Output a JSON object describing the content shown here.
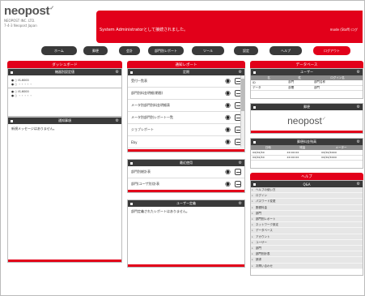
{
  "header": {
    "logo_text": "neopost",
    "logo_mark": "✓",
    "logo_lines": [
      "NEOPOST INC. LTD.",
      "7-4-3 Neopost Japan"
    ],
    "banner_msg": "System Administratorとして接続されました。",
    "banner_user": "mode (Stoff) ログ"
  },
  "nav": [
    {
      "label": "ホーム"
    },
    {
      "label": "郵便"
    },
    {
      "label": "会計"
    },
    {
      "label": "部門別レポート"
    },
    {
      "label": "ツール"
    },
    {
      "label": "設定"
    },
    {
      "label": "ヘルプ"
    },
    {
      "label": "ログアウト",
      "active": true
    }
  ],
  "dashboard": {
    "title": "ダッシュボード",
    "panel1_head": "機器別設定値",
    "tree": [
      "● ○ IS-6000",
      "● ○ ・・・・・",
      "● ○ IS-6000",
      "● ○ ・・・・・"
    ],
    "panel2_head": "通知事項",
    "panel2_text": "新規メッセージはありません。"
  },
  "reports": {
    "title": "通知レポート",
    "panel1_head": "定期",
    "rows": [
      "受付一覧表",
      "部門別料金明細(期間)",
      "メータ別部門別料金明細表",
      "メータ別部門別レポート一覧",
      "ジョブレポート",
      "Eby",
      "・・・"
    ],
    "panel2_head": "最近使用",
    "recent": [
      "部門別総計表",
      "部門(ユーザ別)計表"
    ],
    "panel3_head": "ユーザー定義",
    "panel3_text": "部門定義されたレポートはありません。"
  },
  "database": {
    "title": "データベース",
    "users_head": "ユーザー",
    "users_cols": [
      "名",
      "姓",
      "ログイン名"
    ],
    "users_rows": [
      [
        "ID",
        "部門",
        "部門名称"
      ],
      [
        "データ",
        "部署",
        "部門"
      ]
    ],
    "panel2_head": "郵便",
    "neopost": "neopost",
    "panel3_head": "郵便料金残高",
    "bal_cols": [
      "日時",
      "残高",
      "メーター"
    ],
    "bal_rows": [
      [
        "xx/xx/xx",
        "xx:xx:xx",
        "xx/xx/xxxx"
      ],
      [
        "xx/xx/xx",
        "xx:xx:xx",
        "xx/xx/xxxx"
      ]
    ],
    "help_title": "ヘルプ",
    "help_head": "Q&A",
    "help_items": [
      "ヘルプの使い方",
      "ログイン",
      "パスワード変更",
      "郵便料金",
      "部門",
      "部門別レポート",
      "ネットワーク設定",
      "データベース",
      "アカウント",
      "ユーザー",
      "部門",
      "部門別計表",
      "請求",
      "お問い合わせ"
    ]
  }
}
